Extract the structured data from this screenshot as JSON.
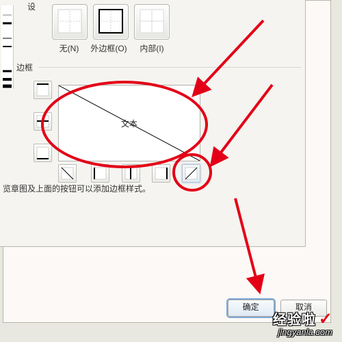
{
  "group": {
    "preset_truncated_label": "设",
    "border_label": "边框"
  },
  "presets": {
    "none_label": "无(N)",
    "box_label": "外边框(O)",
    "inner_label": "内部(I)"
  },
  "preview": {
    "sample_text": "文本"
  },
  "hint": "览章图及上面的按钮可以添加边框样式。",
  "buttons": {
    "ok": "确定",
    "cancel": "取消"
  },
  "watermark": {
    "brand": "经验啦",
    "check": "✓",
    "url": "jingyanla.com"
  },
  "icons": {
    "edge_top": "edge-top-icon",
    "edge_h_mid": "edge-middle-h-icon",
    "edge_bottom": "edge-bottom-icon",
    "edge_left": "edge-left-icon",
    "edge_v_mid": "edge-middle-v-icon",
    "edge_right": "edge-right-icon",
    "diag_down": "diag-down-icon",
    "diag_up": "diag-up-icon"
  },
  "annotation": {
    "stroke": "#e30017",
    "width": 4
  }
}
